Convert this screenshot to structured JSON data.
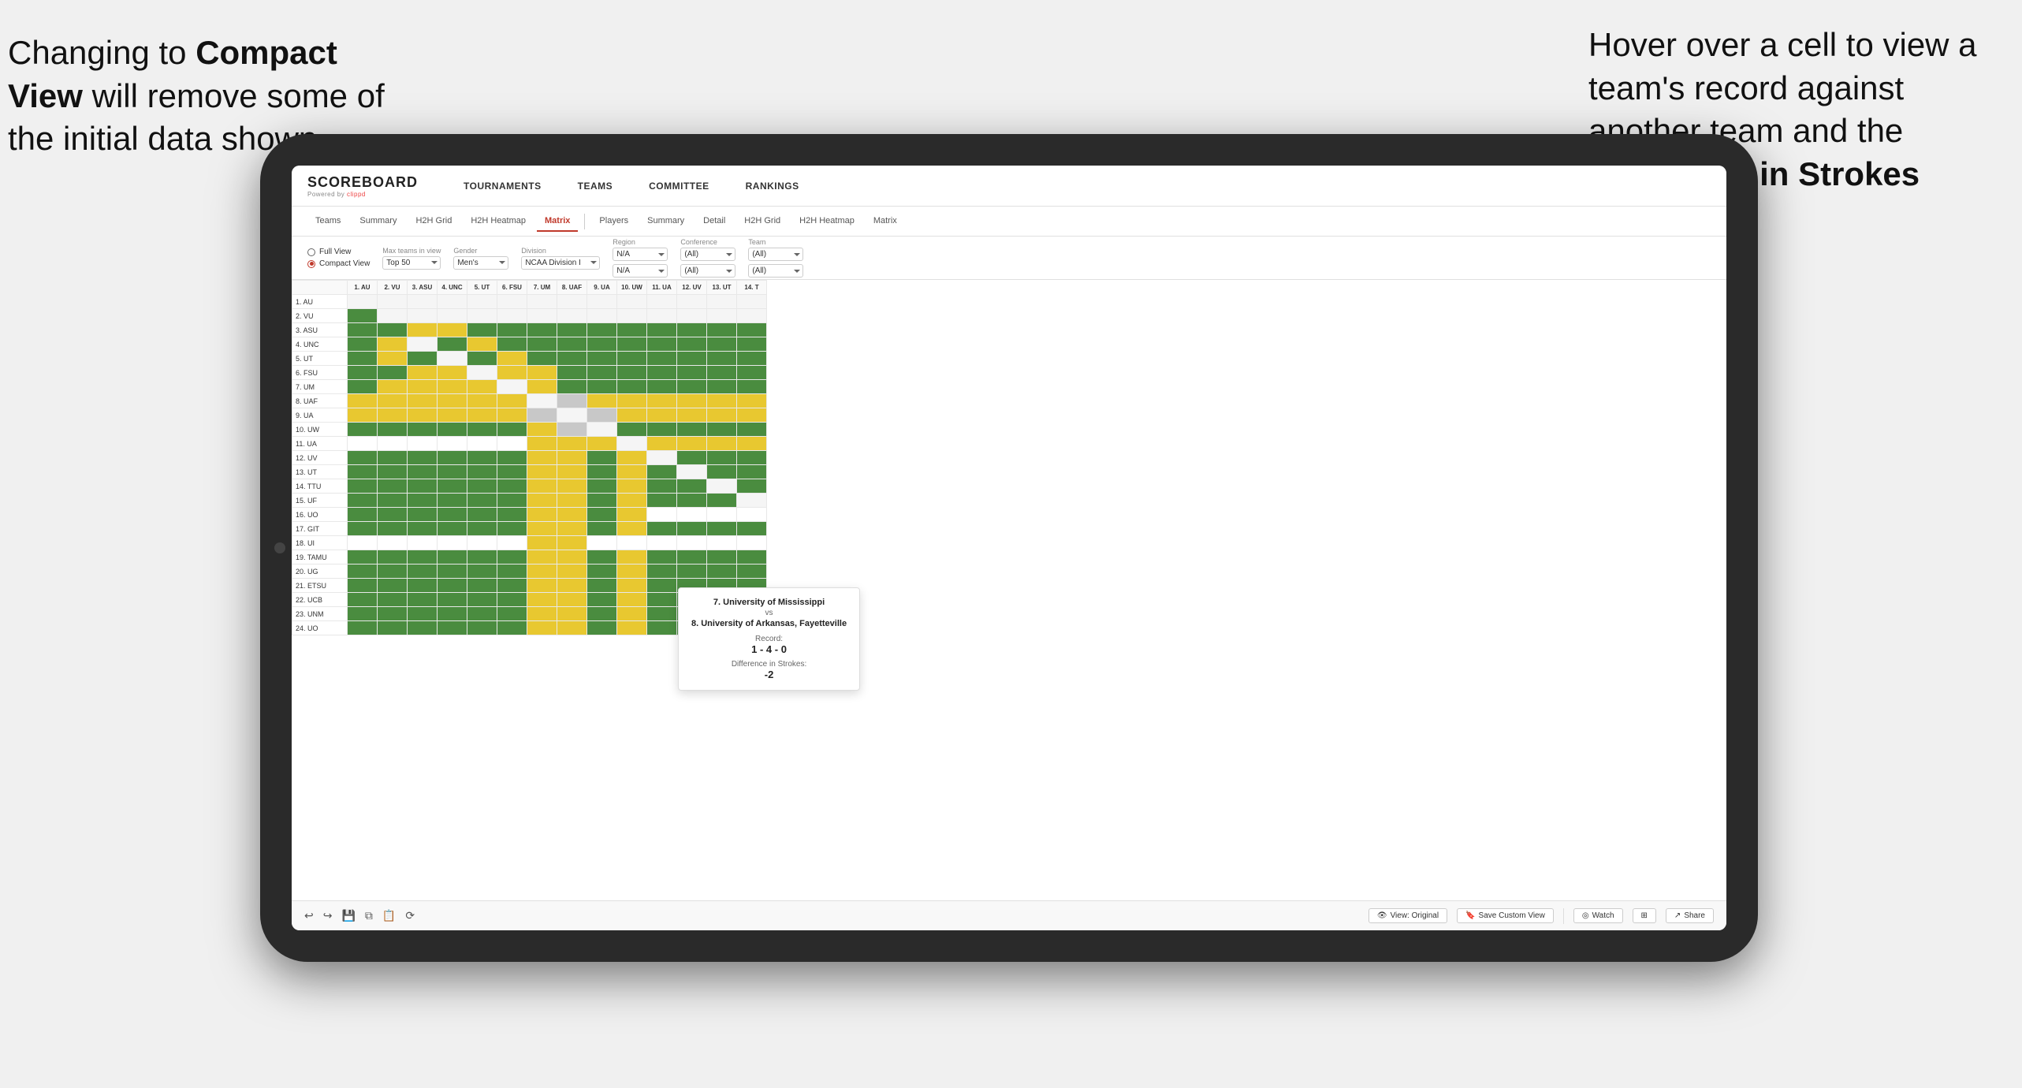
{
  "annotations": {
    "left_text": "Changing to Compact View will remove some of the initial data shown",
    "left_bold": "Compact View",
    "right_text": "Hover over a cell to view a team's record against another team and the Difference in Strokes",
    "right_bold": "Difference in Strokes"
  },
  "nav": {
    "logo": "SCOREBOARD",
    "logo_sub": "Powered by clippd",
    "items": [
      "TOURNAMENTS",
      "TEAMS",
      "COMMITTEE",
      "RANKINGS"
    ]
  },
  "sub_nav": {
    "group1": [
      "Teams",
      "Summary",
      "H2H Grid",
      "H2H Heatmap",
      "Matrix"
    ],
    "group2": [
      "Players",
      "Summary",
      "Detail",
      "H2H Grid",
      "H2H Heatmap",
      "Matrix"
    ],
    "active": "Matrix"
  },
  "filters": {
    "view_options": [
      "Full View",
      "Compact View"
    ],
    "selected_view": "Compact View",
    "max_teams_label": "Max teams in view",
    "max_teams_value": "Top 50",
    "gender_label": "Gender",
    "gender_value": "Men's",
    "division_label": "Division",
    "division_value": "NCAA Division I",
    "region_label": "Region",
    "region_value": "N/A",
    "conference_label": "Conference",
    "conference_value": "(All)",
    "team_label": "Team",
    "team_value": "(All)"
  },
  "col_headers": [
    "1. AU",
    "2. VU",
    "3. ASU",
    "4. UNC",
    "5. UT",
    "6. FSU",
    "7. UM",
    "8. UAF",
    "9. UA",
    "10. UW",
    "11. UA",
    "12. UV",
    "13. UT",
    "14. T"
  ],
  "row_headers": [
    "1. AU",
    "2. VU",
    "3. ASU",
    "4. UNC",
    "5. UT",
    "6. FSU",
    "7. UM",
    "8. UAF",
    "9. UA",
    "10. UW",
    "11. UA",
    "12. UV",
    "13. UT",
    "14. TTU",
    "15. UF",
    "16. UO",
    "17. GIT",
    "18. UI",
    "19. TAMU",
    "20. UG",
    "21. ETSU",
    "22. UCB",
    "23. UNM",
    "24. UO"
  ],
  "tooltip": {
    "team1": "7. University of Mississippi",
    "vs": "vs",
    "team2": "8. University of Arkansas, Fayetteville",
    "record_label": "Record:",
    "record": "1 - 4 - 0",
    "diff_label": "Difference in Strokes:",
    "diff": "-2"
  },
  "toolbar": {
    "view_original": "View: Original",
    "save_custom": "Save Custom View",
    "watch": "Watch",
    "share": "Share"
  }
}
